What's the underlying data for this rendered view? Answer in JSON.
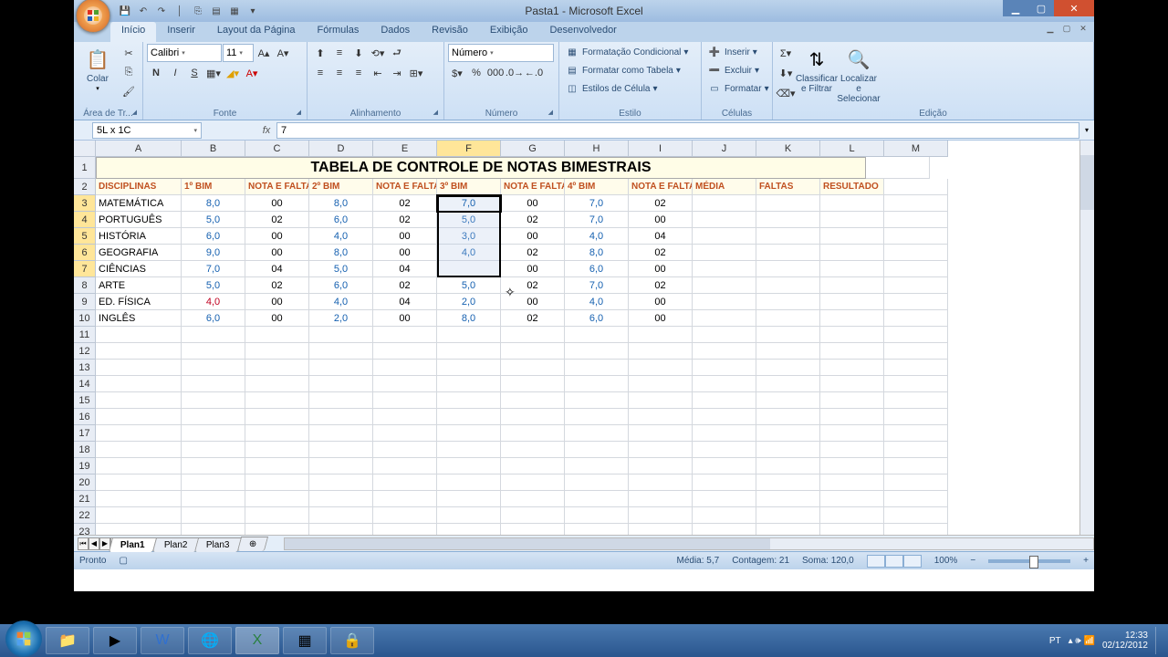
{
  "app": {
    "title": "Pasta1 - Microsoft Excel"
  },
  "tabs": [
    "Início",
    "Inserir",
    "Layout da Página",
    "Fórmulas",
    "Dados",
    "Revisão",
    "Exibição",
    "Desenvolvedor"
  ],
  "activeTab": 0,
  "ribbon": {
    "clipboard": {
      "label": "Área de Tr...",
      "paste": "Colar"
    },
    "font": {
      "label": "Fonte",
      "name": "Calibri",
      "size": "11"
    },
    "align": {
      "label": "Alinhamento"
    },
    "number": {
      "label": "Número",
      "format": "Número"
    },
    "style": {
      "label": "Estilo",
      "cond": "Formatação Condicional",
      "table": "Formatar como Tabela",
      "cell": "Estilos de Célula"
    },
    "cells": {
      "label": "Células",
      "insert": "Inserir",
      "delete": "Excluir",
      "format": "Formatar"
    },
    "edit": {
      "label": "Edição",
      "sort": "Classificar e Filtrar",
      "find": "Localizar e Selecionar"
    }
  },
  "namebox": "5L x 1C",
  "formula": "7",
  "columns": [
    "A",
    "B",
    "C",
    "D",
    "E",
    "F",
    "G",
    "H",
    "I",
    "J",
    "K",
    "L",
    "M"
  ],
  "selectedCols": [
    "F"
  ],
  "selectedRows": [
    3,
    4,
    5,
    6,
    7
  ],
  "title_row": "TABELA DE CONTROLE DE NOTAS BIMESTRAIS",
  "headers": [
    "DISCIPLINAS",
    "1º BIM",
    "NOTA E FALTA",
    "2º BIM",
    "NOTA E FALTA",
    "3º BIM",
    "NOTA E FALTA",
    "4º BIM",
    "NOTA E FALTA",
    "MÉDIA",
    "FALTAS",
    "RESULTADO"
  ],
  "rows": [
    {
      "disc": "MATEMÁTICA",
      "b1": "8,0",
      "f1": "00",
      "b2": "8,0",
      "f2": "02",
      "b3": "7,0",
      "f3": "00",
      "b4": "7,0",
      "f4": "02"
    },
    {
      "disc": "PORTUGUÊS",
      "b1": "5,0",
      "f1": "02",
      "b2": "6,0",
      "f2": "02",
      "b3": "5,0",
      "f3": "02",
      "b4": "7,0",
      "f4": "00"
    },
    {
      "disc": "HISTÓRIA",
      "b1": "6,0",
      "f1": "00",
      "b2": "4,0",
      "f2": "00",
      "b3": "3,0",
      "f3": "00",
      "b4": "4,0",
      "f4": "04"
    },
    {
      "disc": "GEOGRAFIA",
      "b1": "9,0",
      "f1": "00",
      "b2": "8,0",
      "f2": "00",
      "b3": "4,0",
      "f3": "02",
      "b4": "8,0",
      "f4": "02"
    },
    {
      "disc": "CIÊNCIAS",
      "b1": "7,0",
      "f1": "04",
      "b2": "5,0",
      "f2": "04",
      "b3": "",
      "f3": "00",
      "b4": "6,0",
      "f4": "00"
    },
    {
      "disc": "ARTE",
      "b1": "5,0",
      "f1": "02",
      "b2": "6,0",
      "f2": "02",
      "b3": "5,0",
      "f3": "02",
      "b4": "7,0",
      "f4": "02"
    },
    {
      "disc": "ED. FÍSICA",
      "b1": "4,0",
      "f1": "00",
      "b2": "4,0",
      "f2": "04",
      "b3": "2,0",
      "f3": "00",
      "b4": "4,0",
      "f4": "00",
      "red": true
    },
    {
      "disc": "INGLÊS",
      "b1": "6,0",
      "f1": "00",
      "b2": "2,0",
      "f2": "00",
      "b3": "8,0",
      "f3": "02",
      "b4": "6,0",
      "f4": "00"
    }
  ],
  "sheetTabs": [
    "Plan1",
    "Plan2",
    "Plan3"
  ],
  "activeSheet": 0,
  "status": {
    "ready": "Pronto",
    "avg": "Média: 5,7",
    "count": "Contagem: 21",
    "sum": "Soma: 120,0",
    "zoom": "100%"
  },
  "tray": {
    "lang": "PT",
    "time": "12:33",
    "date": "02/12/2012"
  },
  "chart_data": {
    "type": "table",
    "title": "TABELA DE CONTROLE DE NOTAS BIMESTRAIS",
    "columns": [
      "DISCIPLINAS",
      "1º BIM",
      "NOTA E FALTA",
      "2º BIM",
      "NOTA E FALTA",
      "3º BIM",
      "NOTA E FALTA",
      "4º BIM",
      "NOTA E FALTA",
      "MÉDIA",
      "FALTAS",
      "RESULTADO"
    ],
    "data": [
      [
        "MATEMÁTICA",
        8.0,
        "00",
        8.0,
        "02",
        7.0,
        "00",
        7.0,
        "02",
        null,
        null,
        null
      ],
      [
        "PORTUGUÊS",
        5.0,
        "02",
        6.0,
        "02",
        5.0,
        "02",
        7.0,
        "00",
        null,
        null,
        null
      ],
      [
        "HISTÓRIA",
        6.0,
        "00",
        4.0,
        "00",
        3.0,
        "00",
        4.0,
        "04",
        null,
        null,
        null
      ],
      [
        "GEOGRAFIA",
        9.0,
        "00",
        8.0,
        "00",
        4.0,
        "02",
        8.0,
        "02",
        null,
        null,
        null
      ],
      [
        "CIÊNCIAS",
        7.0,
        "04",
        5.0,
        "04",
        null,
        "00",
        6.0,
        "00",
        null,
        null,
        null
      ],
      [
        "ARTE",
        5.0,
        "02",
        6.0,
        "02",
        5.0,
        "02",
        7.0,
        "02",
        null,
        null,
        null
      ],
      [
        "ED. FÍSICA",
        4.0,
        "00",
        4.0,
        "04",
        2.0,
        "00",
        4.0,
        "00",
        null,
        null,
        null
      ],
      [
        "INGLÊS",
        6.0,
        "00",
        2.0,
        "00",
        8.0,
        "02",
        6.0,
        "00",
        null,
        null,
        null
      ]
    ]
  }
}
